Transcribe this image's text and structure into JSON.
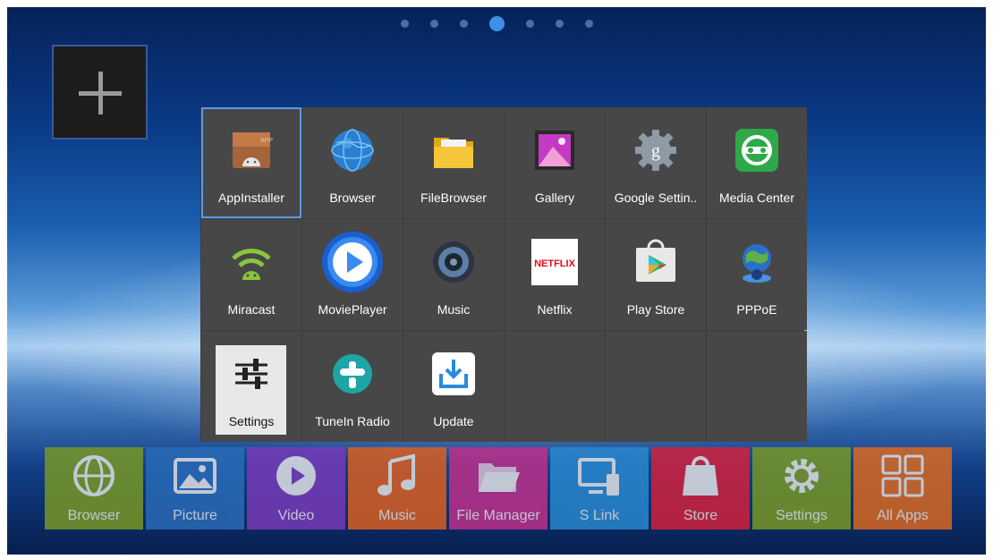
{
  "page_indicator": {
    "count": 7,
    "active_index": 3
  },
  "add_tile": {
    "icon": "plus-icon"
  },
  "app_grid": [
    {
      "label": "AppInstaller",
      "icon": "app-installer-icon",
      "selected": true
    },
    {
      "label": "Browser",
      "icon": "globe-icon"
    },
    {
      "label": "FileBrowser",
      "icon": "folder-icon"
    },
    {
      "label": "Gallery",
      "icon": "gallery-icon"
    },
    {
      "label": "Google Settin..",
      "icon": "google-settings-icon"
    },
    {
      "label": "Media Center",
      "icon": "media-center-icon"
    },
    {
      "label": "Miracast",
      "icon": "miracast-icon"
    },
    {
      "label": "MoviePlayer",
      "icon": "movie-player-icon"
    },
    {
      "label": "Music",
      "icon": "speaker-icon"
    },
    {
      "label": "Netflix",
      "icon": "netflix-icon",
      "logo_text": "NETFLIX"
    },
    {
      "label": "Play Store",
      "icon": "play-store-icon"
    },
    {
      "label": "PPPoE",
      "icon": "pppoe-icon"
    },
    {
      "label": "Settings",
      "icon": "sliders-icon",
      "highlighted": true
    },
    {
      "label": "TuneIn Radio",
      "icon": "tunein-icon"
    },
    {
      "label": "Update",
      "icon": "download-icon"
    }
  ],
  "bottom_bar": [
    {
      "label": "Browser",
      "color": "#7a9a22",
      "icon": "globe-icon"
    },
    {
      "label": "Picture",
      "color": "#2a6cb8",
      "icon": "picture-icon"
    },
    {
      "label": "Video",
      "color": "#7a3ab8",
      "icon": "play-icon"
    },
    {
      "label": "Music",
      "color": "#e0601e",
      "icon": "music-note-icon"
    },
    {
      "label": "File Manager",
      "color": "#c2308a",
      "icon": "folder-open-icon"
    },
    {
      "label": "S Link",
      "color": "#2a8ad0",
      "icon": "screen-link-icon"
    },
    {
      "label": "Store",
      "color": "#d8203a",
      "icon": "shopping-bag-icon"
    },
    {
      "label": "Settings",
      "color": "#7a9a22",
      "icon": "gear-icon"
    },
    {
      "label": "All Apps",
      "color": "#e06a1e",
      "icon": "grid-icon"
    }
  ]
}
